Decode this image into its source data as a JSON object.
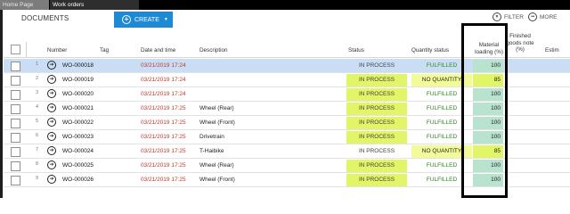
{
  "tabs": [
    {
      "label": "Home Page"
    },
    {
      "label": "Work orders"
    }
  ],
  "page": {
    "title": "DOCUMENTS"
  },
  "toolbar": {
    "create_label": "CREATE",
    "filter_label": "FILTER",
    "more_label": "MORE"
  },
  "colors": {
    "accent": "#1e8ad6",
    "status_highlight": "#e1f566",
    "material_full": "#b7e3cf",
    "material_partial": "#e1f566",
    "fulfilled_text": "#2a8a1c",
    "date_text": "#c0392b",
    "selected_row": "#c9def5"
  },
  "table": {
    "columns": {
      "number": "Number",
      "tag": "Tag",
      "date_time": "Date and time",
      "description": "Description",
      "status": "Status",
      "quantity_status": "Quantity status",
      "material_loading": "Material loading (%)",
      "finished_goods": "Finished goods note (%)",
      "estimate": "Estim"
    },
    "rows": [
      {
        "index": "1",
        "number": "WO-000018",
        "date": "03/21/2019 17:24",
        "description": "",
        "status": "IN PROCESS",
        "qty_status": "FULFILLED",
        "material": "100",
        "status_hl": false,
        "selected": true
      },
      {
        "index": "2",
        "number": "WO-000019",
        "date": "03/21/2019 17:24",
        "description": "",
        "status": "IN PROCESS",
        "qty_status": "NO QUANTITY",
        "material": "85",
        "status_hl": true,
        "selected": false
      },
      {
        "index": "3",
        "number": "WO-000020",
        "date": "03/21/2019 17:24",
        "description": "",
        "status": "IN PROCESS",
        "qty_status": "FULFILLED",
        "material": "100",
        "status_hl": true,
        "selected": false
      },
      {
        "index": "4",
        "number": "WO-000021",
        "date": "03/21/2019 17:25",
        "description": "Wheel (Rear)",
        "status": "IN PROCESS",
        "qty_status": "FULFILLED",
        "material": "100",
        "status_hl": true,
        "selected": false
      },
      {
        "index": "5",
        "number": "WO-000022",
        "date": "03/21/2019 17:25",
        "description": "Wheel (Front)",
        "status": "IN PROCESS",
        "qty_status": "FULFILLED",
        "material": "100",
        "status_hl": true,
        "selected": false
      },
      {
        "index": "6",
        "number": "WO-000023",
        "date": "03/21/2019 17:25",
        "description": "Drivetrain",
        "status": "IN PROCESS",
        "qty_status": "FULFILLED",
        "material": "100",
        "status_hl": true,
        "selected": false
      },
      {
        "index": "7",
        "number": "WO-000024",
        "date": "03/21/2019 17:25",
        "description": "T-Haibike",
        "status": "IN PROCESS",
        "qty_status": "NO QUANTITY",
        "material": "85",
        "status_hl": false,
        "selected": false
      },
      {
        "index": "8",
        "number": "WO-000025",
        "date": "03/21/2019 17:25",
        "description": "Wheel (Rear)",
        "status": "IN PROCESS",
        "qty_status": "FULFILLED",
        "material": "100",
        "status_hl": true,
        "selected": false
      },
      {
        "index": "9",
        "number": "WO-000026",
        "date": "03/21/2019 17:25",
        "description": "Wheel (Front)",
        "status": "IN PROCESS",
        "qty_status": "FULFILLED",
        "material": "100",
        "status_hl": true,
        "selected": false
      }
    ]
  }
}
